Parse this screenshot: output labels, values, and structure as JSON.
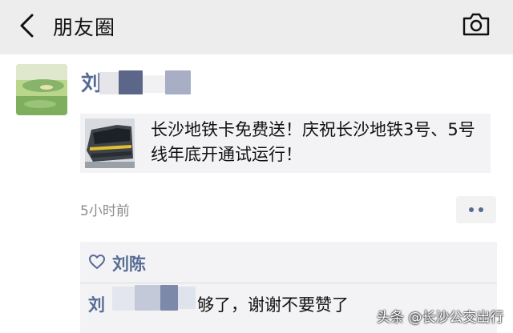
{
  "header": {
    "title": "朋友圈",
    "back_icon": "chevron-left-icon",
    "camera_icon": "camera-icon"
  },
  "post": {
    "author": "刘",
    "share_card": {
      "text": "长沙地铁卡免费送！庆祝长沙地铁3号、5号线年底开通试运行！"
    },
    "time": "5小时前",
    "more_icon": "more-dots-icon"
  },
  "likes": {
    "icon": "heart-icon",
    "names": "刘陈"
  },
  "comment": {
    "author": "刘",
    "text": "够了，谢谢不要赞了"
  },
  "watermark": "头条 @长沙公交出行",
  "colors": {
    "link": "#576b95",
    "topbar": "#ededed",
    "card": "#f3f3f5",
    "meta": "#8c8c8c"
  }
}
